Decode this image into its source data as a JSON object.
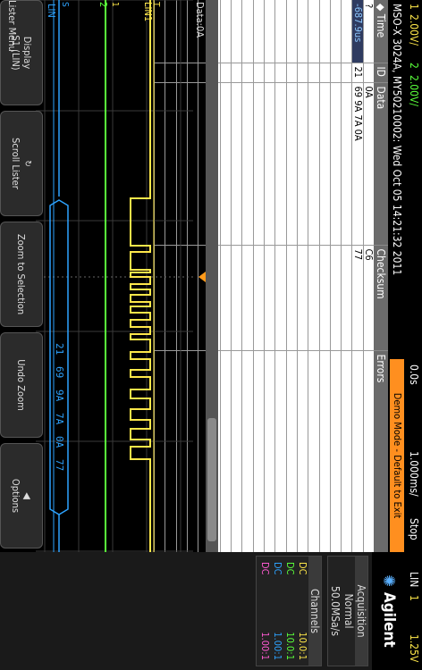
{
  "status": {
    "ch1_num": "1",
    "ch1_scale": "2.00V/",
    "ch2_num": "2",
    "ch2_scale": "2.00V/",
    "delay": "0.0s",
    "timebase": "1.000ms/",
    "run_state": "Stop",
    "trigger_source": "LIN",
    "trigger_channel": "1",
    "trigger_level": "1.25V"
  },
  "header": {
    "model_info": "MSO-X 3024A, MY50210002: Wed Oct 05 14:21:32 2011",
    "demo_banner": "Demo Mode - Default to Exit"
  },
  "lister": {
    "columns": [
      "Time",
      "ID",
      "Data",
      "Checksum",
      "Errors"
    ],
    "rows": [
      {
        "time": "?",
        "id": "",
        "data": "0A",
        "checksum": "C6",
        "errors": ""
      },
      {
        "time": "-687.9us",
        "id": "21",
        "data": "69 9A 7A 0A",
        "checksum": "77",
        "errors": ""
      }
    ],
    "empty_rows": 18
  },
  "waveform": {
    "data_label": "Data:0A",
    "ch1_label": "LIN1",
    "ch2_marker": "2",
    "lin_label": "LIN",
    "serial_markers": [
      "S",
      "1",
      "T"
    ],
    "decode_values": [
      "21",
      "69",
      "9A",
      "7A",
      "0A",
      "77"
    ],
    "ground_markers": [
      "1",
      "2"
    ]
  },
  "panel": {
    "brand": "Agilent",
    "acquisition_title": "Acquisition",
    "acq_mode": "Normal",
    "sample_rate": "50.0MSa/s",
    "channels_title": "Channels",
    "channels": [
      {
        "coupling": "DC",
        "ratio": "10.0:1"
      },
      {
        "coupling": "DC",
        "ratio": "10.0:1"
      },
      {
        "coupling": "DC",
        "ratio": "1.00:1"
      },
      {
        "coupling": "DC",
        "ratio": "1.00:1"
      }
    ]
  },
  "softkeys": {
    "menu_title": "Lister Menu",
    "display_label": "Display",
    "display_value": "S1 (LIN)",
    "scroll_label": "Scroll Lister",
    "zoom_label": "Zoom to Selection",
    "undo_label": "Undo Zoom",
    "options_label": "Options"
  },
  "colors": {
    "ch1": "#ffe84a",
    "ch2": "#59ff3a",
    "ch3": "#2da3ff",
    "ch4": "#ff5ad2",
    "trigger_marker": "#ff9a1a",
    "decode_bus": "#2da3ff",
    "selected_row_text": "#8ec8ff"
  }
}
